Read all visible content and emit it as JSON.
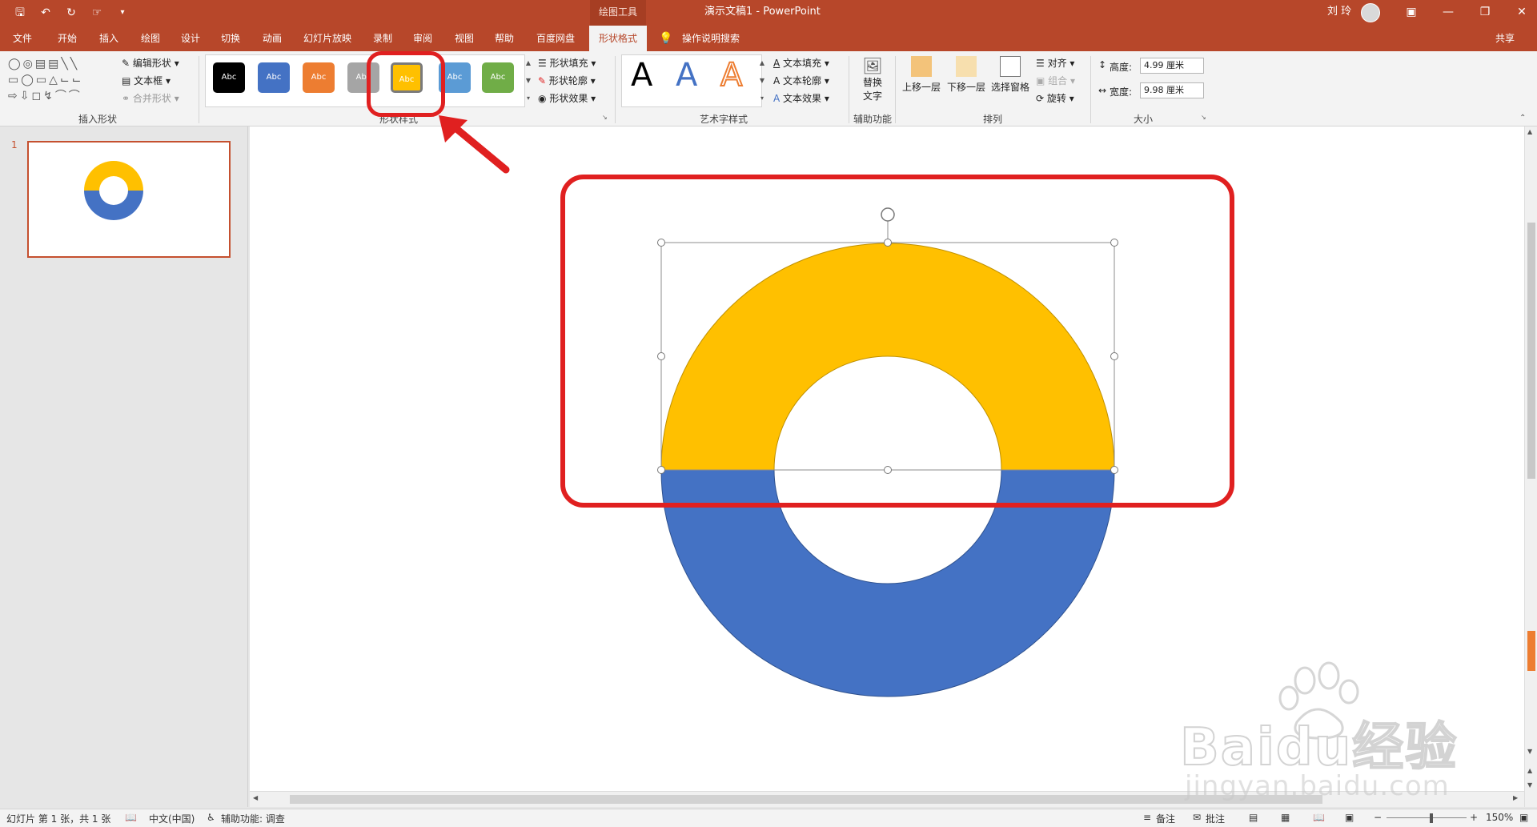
{
  "titlebar": {
    "context_tab": "绘图工具",
    "document_title": "演示文稿1  -  PowerPoint",
    "user_name": "刘 玲",
    "qat_icons": [
      "save-icon",
      "undo-icon",
      "redo-icon",
      "touch-mode-icon",
      "customize-icon"
    ]
  },
  "menu": {
    "tabs": [
      "文件",
      "开始",
      "插入",
      "绘图",
      "设计",
      "切换",
      "动画",
      "幻灯片放映",
      "录制",
      "审阅",
      "视图",
      "帮助",
      "百度网盘",
      "形状格式"
    ],
    "active_tab": "形状格式",
    "search": "操作说明搜索",
    "share": "共享"
  },
  "ribbon": {
    "insert_shapes": {
      "label": "插入形状",
      "edit_shape": "编辑形状",
      "text_box": "文本框",
      "merge_shapes": "合并形状"
    },
    "shape_styles": {
      "label": "形状样式",
      "presets": [
        {
          "text": "Abc",
          "color": "#000000"
        },
        {
          "text": "Abc",
          "color": "#4472c4"
        },
        {
          "text": "Abc",
          "color": "#ed7d31"
        },
        {
          "text": "Abc",
          "color": "#a5a5a5"
        },
        {
          "text": "Abc",
          "color": "#ffc000"
        },
        {
          "text": "Abc",
          "color": "#5b9bd5"
        },
        {
          "text": "Abc",
          "color": "#70ad47"
        }
      ],
      "fill": "形状填充",
      "outline": "形状轮廓",
      "effects": "形状效果"
    },
    "wordart": {
      "label": "艺术字样式",
      "text_fill": "文本填充",
      "text_outline": "文本轮廓",
      "text_effects": "文本效果",
      "letter": "A"
    },
    "accessibility": {
      "label": "辅助功能",
      "alt_text_line1": "替换",
      "alt_text_line2": "文字"
    },
    "arrange": {
      "label": "排列",
      "bring_forward": "上移一层",
      "send_backward": "下移一层",
      "selection_pane": "选择窗格",
      "align": "对齐",
      "group": "组合",
      "rotate": "旋转"
    },
    "size": {
      "label": "大小",
      "height_label": "高度:",
      "height_value": "4.99 厘米",
      "width_label": "宽度:",
      "width_value": "9.98 厘米"
    }
  },
  "slides_panel": {
    "slide_number": "1"
  },
  "shapes": {
    "top_color": "#ffc000",
    "bottom_color": "#4472c4",
    "highlight_color": "#e02020"
  },
  "status": {
    "slide_info": "幻灯片 第 1 张，共 1 张",
    "language": "中文(中国)",
    "accessibility": "辅助功能: 调查",
    "notes": "备注",
    "comments": "批注",
    "zoom": "150%"
  },
  "watermark": {
    "line1": "Baidu经验",
    "line2": "jingyan.baidu.com"
  }
}
